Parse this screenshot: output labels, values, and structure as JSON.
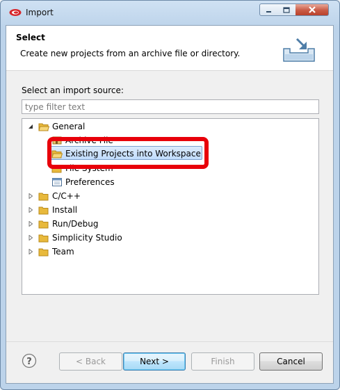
{
  "window": {
    "title": "Import"
  },
  "header": {
    "title": "Select",
    "description": "Create new projects from an archive file or directory."
  },
  "filter": {
    "label": "Select an import source:",
    "placeholder": "type filter text"
  },
  "tree": {
    "general": {
      "label": "General",
      "children": {
        "archive": "Archive File",
        "existing": "Existing Projects into Workspace",
        "filesystem": "File System",
        "preferences": "Preferences"
      }
    },
    "cpp": "C/C++",
    "install": "Install",
    "rundebug": "Run/Debug",
    "simplicity": "Simplicity Studio",
    "team": "Team"
  },
  "buttons": {
    "back": "< Back",
    "next": "Next >",
    "finish": "Finish",
    "cancel": "Cancel"
  },
  "colors": {
    "highlight_ring": "#e8000a",
    "folder": "#e8b93c",
    "selection": "#c1dcfc"
  }
}
